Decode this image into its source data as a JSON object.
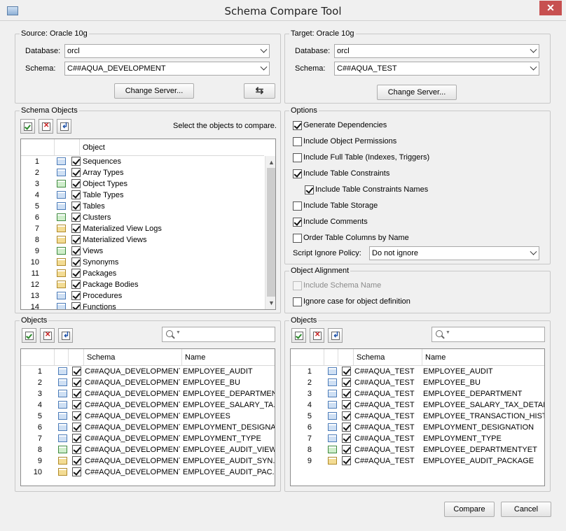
{
  "window": {
    "title": "Schema Compare Tool",
    "close_glyph": "✕"
  },
  "source": {
    "group_title": "Source: Oracle 10g",
    "database_label": "Database:",
    "database_value": "orcl",
    "schema_label": "Schema:",
    "schema_value": "C##AQUA_DEVELOPMENT",
    "change_server": "Change Server...",
    "swap_glyph": "⇆"
  },
  "target": {
    "group_title": "Target: Oracle 10g",
    "database_label": "Database:",
    "database_value": "orcl",
    "schema_label": "Schema:",
    "schema_value": "C##AQUA_TEST",
    "change_server": "Change Server..."
  },
  "schema_objects": {
    "group_title": "Schema Objects",
    "hint": "Select the objects to compare.",
    "column_object": "Object",
    "rows": [
      {
        "n": "1",
        "label": "Sequences",
        "icon": "sequence-icon"
      },
      {
        "n": "2",
        "label": "Array Types",
        "icon": "array-type-icon"
      },
      {
        "n": "3",
        "label": "Object Types",
        "icon": "object-type-icon"
      },
      {
        "n": "4",
        "label": "Table Types",
        "icon": "table-type-icon"
      },
      {
        "n": "5",
        "label": "Tables",
        "icon": "table-icon"
      },
      {
        "n": "6",
        "label": "Clusters",
        "icon": "cluster-icon"
      },
      {
        "n": "7",
        "label": "Materialized View Logs",
        "icon": "mview-log-icon"
      },
      {
        "n": "8",
        "label": "Materialized Views",
        "icon": "mview-icon"
      },
      {
        "n": "9",
        "label": "Views",
        "icon": "view-icon"
      },
      {
        "n": "10",
        "label": "Synonyms",
        "icon": "synonym-icon"
      },
      {
        "n": "11",
        "label": "Packages",
        "icon": "package-icon"
      },
      {
        "n": "12",
        "label": "Package Bodies",
        "icon": "package-body-icon"
      },
      {
        "n": "13",
        "label": "Procedures",
        "icon": "procedure-icon"
      },
      {
        "n": "14",
        "label": "Functions",
        "icon": "function-icon"
      }
    ]
  },
  "options": {
    "group_title": "Options",
    "items": [
      {
        "label": "Generate Dependencies",
        "checked": true
      },
      {
        "label": "Include Object Permissions",
        "checked": false
      },
      {
        "label": "Include Full Table (Indexes, Triggers)",
        "checked": false
      },
      {
        "label": "Include Table Constraints",
        "checked": true
      },
      {
        "label": "Include Table Constraints Names",
        "checked": true
      },
      {
        "label": "Include Table Storage",
        "checked": false
      },
      {
        "label": "Include Comments",
        "checked": true
      },
      {
        "label": "Order Table Columns by Name",
        "checked": false
      }
    ],
    "ignore_policy_label": "Script Ignore Policy:",
    "ignore_policy_value": "Do not ignore"
  },
  "alignment": {
    "group_title": "Object Alignment",
    "include_schema_name": "Include Schema Name",
    "ignore_case": "Ignore case for object definition"
  },
  "source_objects": {
    "group_title": "Objects",
    "col_schema": "Schema",
    "col_name": "Name",
    "rows": [
      {
        "n": "1",
        "schema": "C##AQUA_DEVELOPMENT",
        "name": "EMPLOYEE_AUDIT",
        "icon": "table-icon"
      },
      {
        "n": "2",
        "schema": "C##AQUA_DEVELOPMENT",
        "name": "EMPLOYEE_BU",
        "icon": "table-icon"
      },
      {
        "n": "3",
        "schema": "C##AQUA_DEVELOPMENT",
        "name": "EMPLOYEE_DEPARTMENT",
        "icon": "table-icon"
      },
      {
        "n": "4",
        "schema": "C##AQUA_DEVELOPMENT",
        "name": "EMPLOYEE_SALARY_TA...",
        "icon": "table-icon"
      },
      {
        "n": "5",
        "schema": "C##AQUA_DEVELOPMENT",
        "name": "EMPLOYEES",
        "icon": "table-icon"
      },
      {
        "n": "6",
        "schema": "C##AQUA_DEVELOPMENT",
        "name": "EMPLOYMENT_DESIGNA...",
        "icon": "table-icon"
      },
      {
        "n": "7",
        "schema": "C##AQUA_DEVELOPMENT",
        "name": "EMPLOYMENT_TYPE",
        "icon": "table-icon"
      },
      {
        "n": "8",
        "schema": "C##AQUA_DEVELOPMENT",
        "name": "EMPLOYEE_AUDIT_VIEW",
        "icon": "view-icon"
      },
      {
        "n": "9",
        "schema": "C##AQUA_DEVELOPMENT",
        "name": "EMPLOYEE_AUDIT_SYN...",
        "icon": "synonym-icon"
      },
      {
        "n": "10",
        "schema": "C##AQUA_DEVELOPMENT",
        "name": "EMPLOYEE_AUDIT_PAC...",
        "icon": "package-icon"
      }
    ]
  },
  "target_objects": {
    "group_title": "Objects",
    "col_schema": "Schema",
    "col_name": "Name",
    "rows": [
      {
        "n": "1",
        "schema": "C##AQUA_TEST",
        "name": "EMPLOYEE_AUDIT",
        "icon": "table-icon"
      },
      {
        "n": "2",
        "schema": "C##AQUA_TEST",
        "name": "EMPLOYEE_BU",
        "icon": "table-icon"
      },
      {
        "n": "3",
        "schema": "C##AQUA_TEST",
        "name": "EMPLOYEE_DEPARTMENT",
        "icon": "table-icon"
      },
      {
        "n": "4",
        "schema": "C##AQUA_TEST",
        "name": "EMPLOYEE_SALARY_TAX_DETAILS",
        "icon": "table-icon"
      },
      {
        "n": "5",
        "schema": "C##AQUA_TEST",
        "name": "EMPLOYEE_TRANSACTION_HIST...",
        "icon": "table-icon"
      },
      {
        "n": "6",
        "schema": "C##AQUA_TEST",
        "name": "EMPLOYMENT_DESIGNATION",
        "icon": "table-icon"
      },
      {
        "n": "7",
        "schema": "C##AQUA_TEST",
        "name": "EMPLOYMENT_TYPE",
        "icon": "table-icon"
      },
      {
        "n": "8",
        "schema": "C##AQUA_TEST",
        "name": "EMPLOYEE_DEPARTMENTYET",
        "icon": "view-icon"
      },
      {
        "n": "9",
        "schema": "C##AQUA_TEST",
        "name": "EMPLOYEE_AUDIT_PACKAGE",
        "icon": "package-icon"
      }
    ]
  },
  "footer": {
    "compare": "Compare",
    "cancel": "Cancel"
  }
}
